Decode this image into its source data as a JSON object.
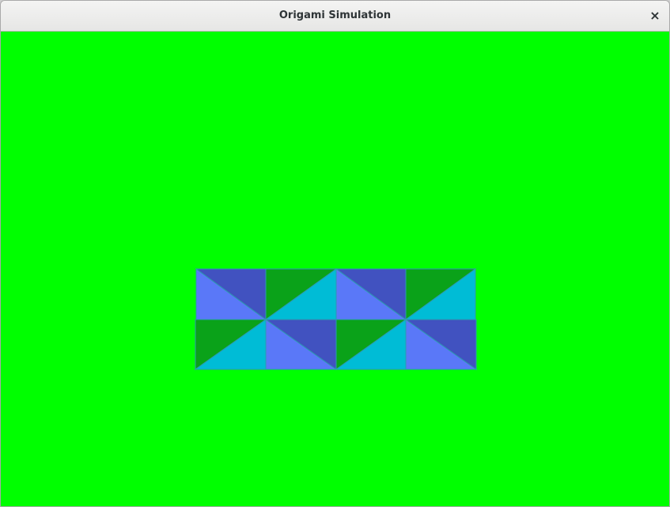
{
  "window": {
    "title": "Origami Simulation",
    "close_glyph": "×",
    "close_icon": "close-icon"
  },
  "canvas": {
    "background_color": "#00ff00",
    "model_colors": {
      "light_blue": "#5a78f8",
      "dark_blue": "#4152c0",
      "dark_green": "#0aa219",
      "cyan": "#00bcd6",
      "edge": "#2c9ab0"
    }
  }
}
